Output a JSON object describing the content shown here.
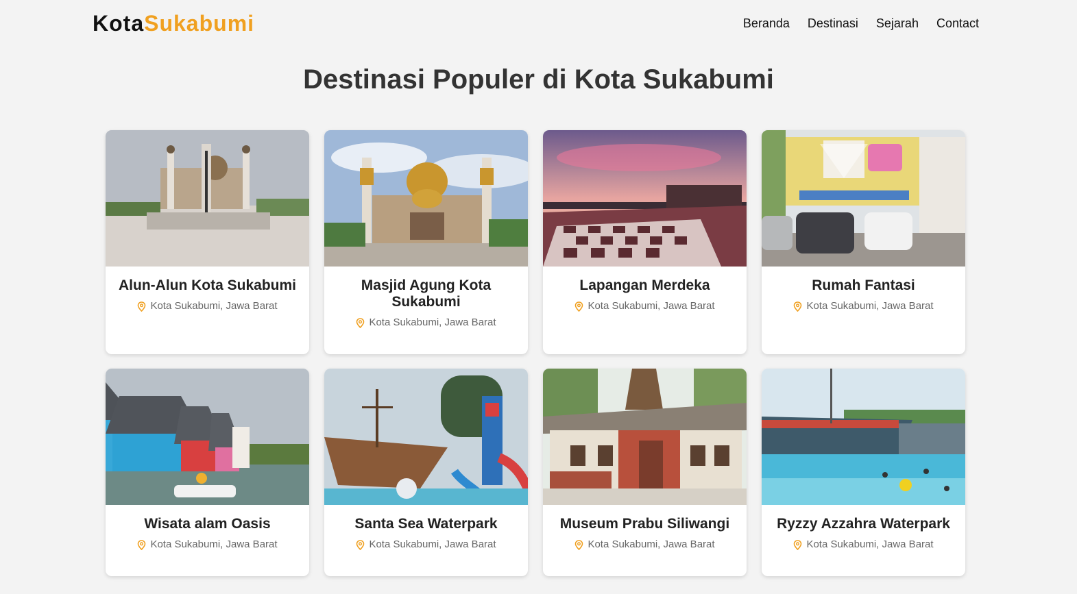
{
  "brand": {
    "part1": "Kota",
    "part2": "Sukabumi"
  },
  "nav": [
    "Beranda",
    "Destinasi",
    "Sejarah",
    "Contact"
  ],
  "page_title": "Destinasi Populer di Kota Sukabumi",
  "colors": {
    "accent": "#f0a020",
    "background": "#f3f3f3"
  },
  "location_icon": "map-pin-icon",
  "destinations": [
    {
      "name": "Alun-Alun Kota Sukabumi",
      "location": "Kota Sukabumi, Jawa Barat",
      "photo": "town square with mosque towers and monument"
    },
    {
      "name": "Masjid Agung Kota Sukabumi",
      "location": "Kota Sukabumi, Jawa Barat",
      "photo": "great mosque with golden domes"
    },
    {
      "name": "Lapangan Merdeka",
      "location": "Kota Sukabumi, Jawa Barat",
      "photo": "field with checkered plaza at sunset"
    },
    {
      "name": "Rumah Fantasi",
      "location": "Kota Sukabumi, Jawa Barat",
      "photo": "museum building with parked cars"
    },
    {
      "name": "Wisata alam Oasis",
      "location": "Kota Sukabumi, Jawa Barat",
      "photo": "colorful cottages by a lake"
    },
    {
      "name": "Santa Sea Waterpark",
      "location": "Kota Sukabumi, Jawa Barat",
      "photo": "pirate ship and water slides"
    },
    {
      "name": "Museum Prabu Siliwangi",
      "location": "Kota Sukabumi, Jawa Barat",
      "photo": "brick museum building with traditional roof"
    },
    {
      "name": "Ryzzy Azzahra Waterpark",
      "location": "Kota Sukabumi, Jawa Barat",
      "photo": "wave pool with ship structure"
    }
  ]
}
